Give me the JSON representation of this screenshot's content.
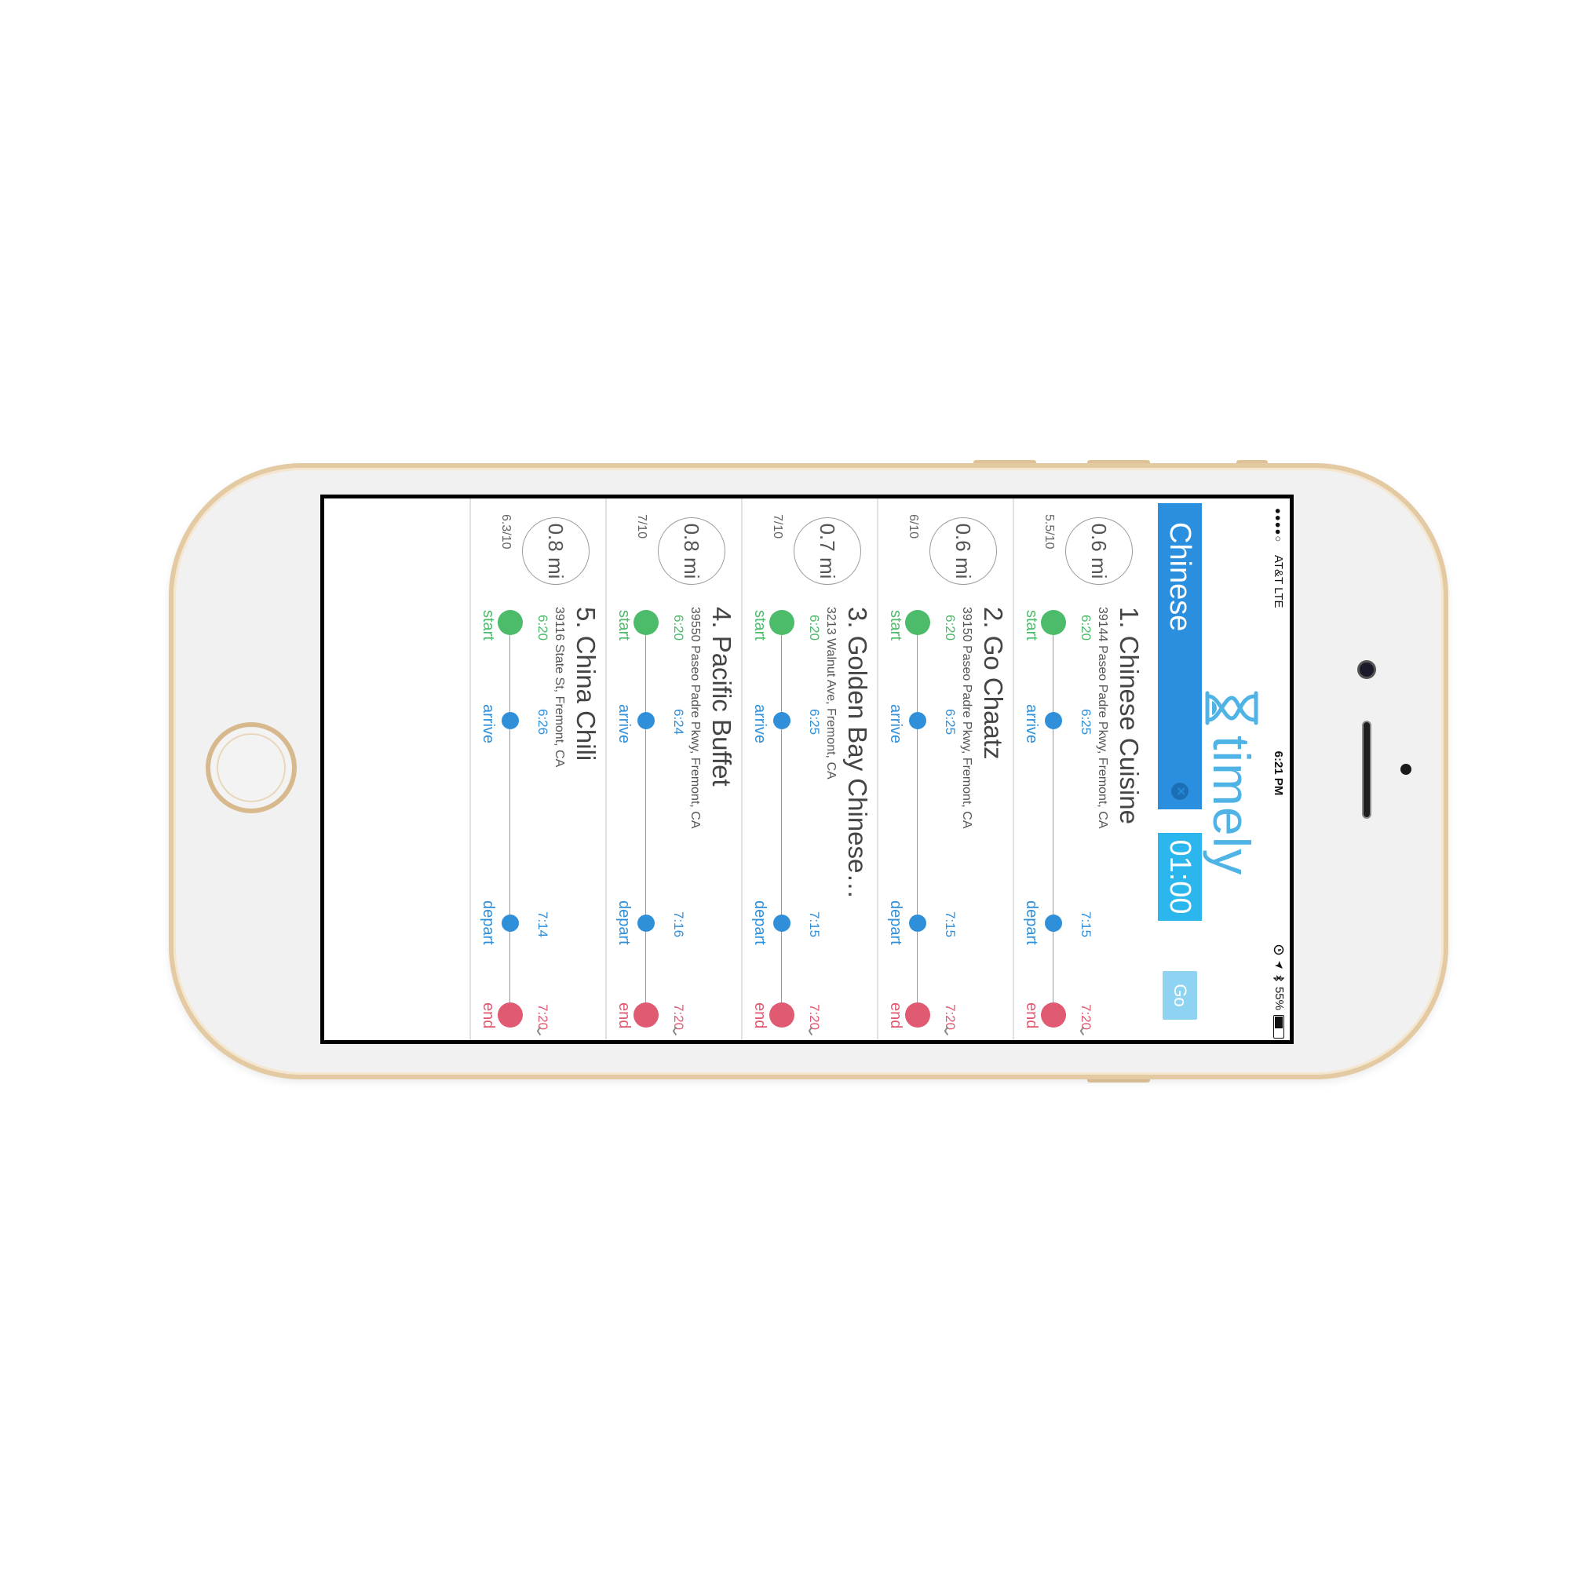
{
  "colors": {
    "start": "#4cbb6a",
    "arrive": "#2f8fd8",
    "end": "#e05a72",
    "brand": "#4fb3e6"
  },
  "status_bar": {
    "signal": "●●●●○",
    "carrier": "AT&T  LTE",
    "time": "6:21 PM",
    "battery": "55%",
    "battery_level": 0.55
  },
  "header": {
    "logo_text": "timely",
    "search_chip": "Chinese",
    "timer": "01:00",
    "go_button": "Go"
  },
  "timeline_labels": {
    "start": "start",
    "arrive": "arrive",
    "depart": "depart",
    "end": "end"
  },
  "restaurants": [
    {
      "name": "1.  Chinese Cuisine",
      "address": "39144 Paseo Padre Pkwy, Fremont, CA",
      "distance": "0.6 mi",
      "rating": "5.5/10",
      "start_time": "6:20",
      "arrive_time": "6:25",
      "depart_time": "7:15",
      "end_time": "7:20"
    },
    {
      "name": "2.  Go Chaatz",
      "address": "39150 Paseo Padre Pkwy, Fremont, CA",
      "distance": "0.6 mi",
      "rating": "6/10",
      "start_time": "6:20",
      "arrive_time": "6:25",
      "depart_time": "7:15",
      "end_time": "7:20"
    },
    {
      "name": "3.  Golden Bay Chinese…",
      "address": "3213 Walnut Ave, Fremont, CA",
      "distance": "0.7 mi",
      "rating": "7/10",
      "start_time": "6:20",
      "arrive_time": "6:25",
      "depart_time": "7:15",
      "end_time": "7:20"
    },
    {
      "name": "4.  Pacific Buffet",
      "address": "39550 Paseo Padre Pkwy, Fremont, CA",
      "distance": "0.8 mi",
      "rating": "7/10",
      "start_time": "6:20",
      "arrive_time": "6:24",
      "depart_time": "7:16",
      "end_time": "7:20"
    },
    {
      "name": "5.  China Chili",
      "address": "39116 State St, Fremont, CA",
      "distance": "0.8 mi",
      "rating": "6.3/10",
      "start_time": "6:20",
      "arrive_time": "6:26",
      "depart_time": "7:14",
      "end_time": "7:20"
    }
  ]
}
